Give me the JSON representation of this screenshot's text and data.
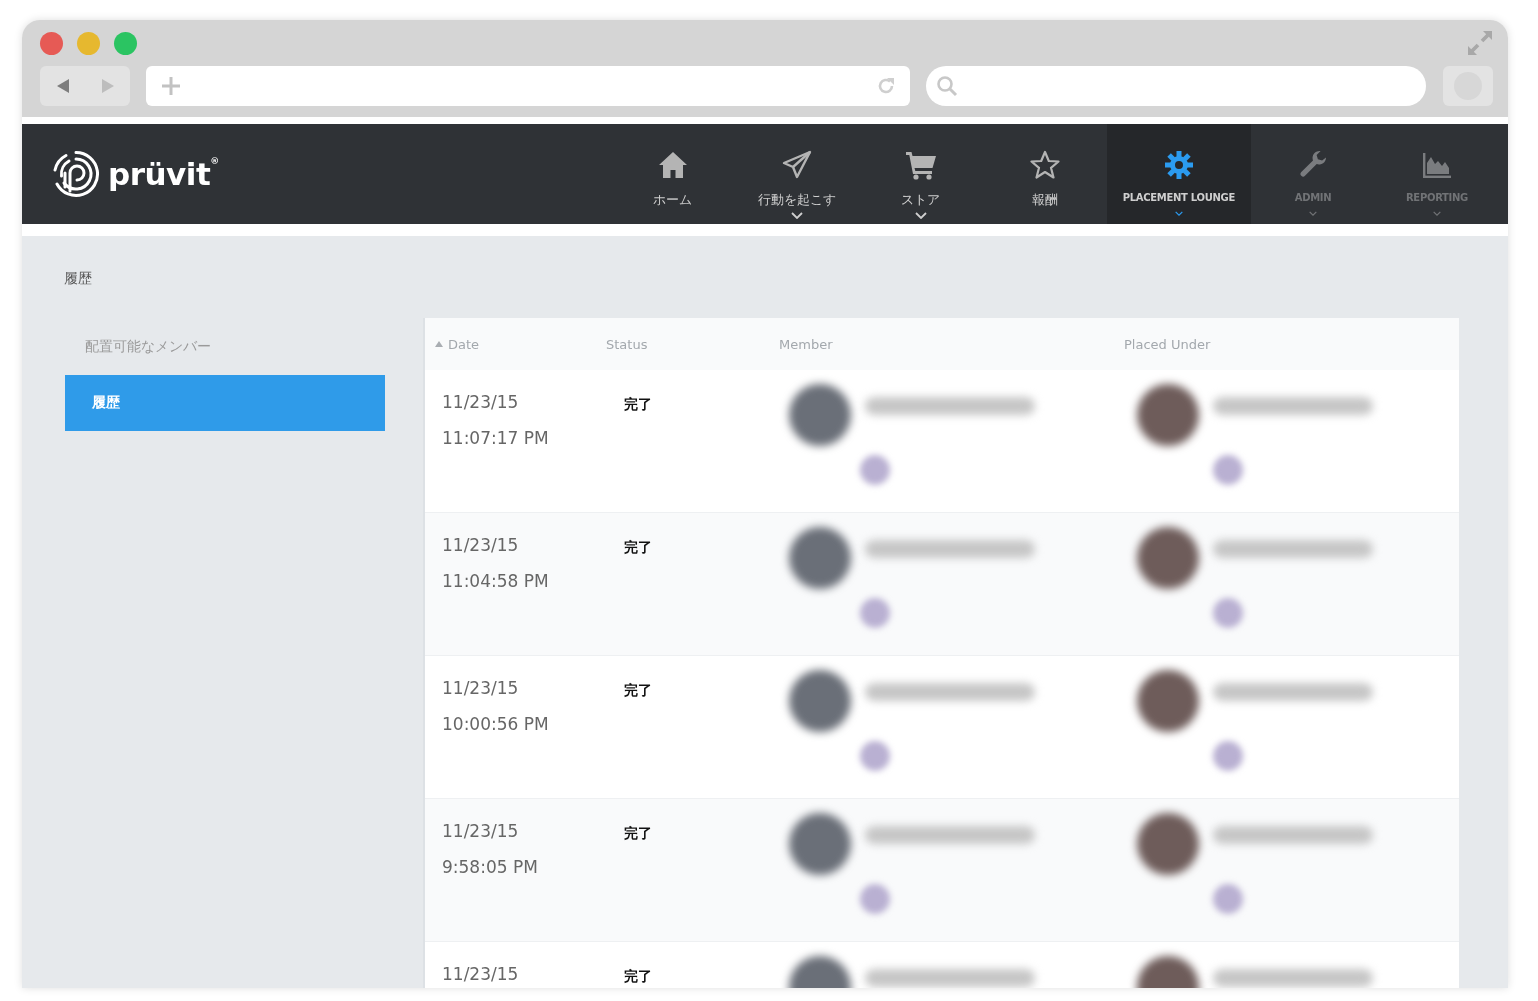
{
  "browser": {
    "window_controls": [
      {
        "color": "#e65a55"
      },
      {
        "color": "#e6b82f"
      },
      {
        "color": "#2bc462"
      }
    ]
  },
  "header": {
    "logo": "prüvit$^{®}$",
    "nav": [
      {
        "label": "ホーム",
        "kind": "primary",
        "selected": false,
        "disabled": false,
        "dropdown": false
      },
      {
        "label": "行動を起こす",
        "kind": "primary",
        "selected": false,
        "disabled": false,
        "dropdown": true
      },
      {
        "label": "ストア",
        "kind": "primary",
        "selected": false,
        "disabled": false,
        "dropdown": true
      },
      {
        "label": "報酬",
        "kind": "primary",
        "selected": false,
        "disabled": false,
        "dropdown": false
      },
      {
        "label": "PLACEMENT LOUNGE",
        "kind": "secondary",
        "selected": true,
        "disabled": false,
        "dropdown": true
      },
      {
        "label": "ADMIN",
        "kind": "secondary",
        "selected": false,
        "disabled": true,
        "dropdown": true
      },
      {
        "label": "REPORTING",
        "kind": "secondary",
        "selected": false,
        "disabled": true,
        "dropdown": true
      }
    ]
  },
  "sidebar": {
    "title": "履歴",
    "items": [
      {
        "label": "配置可能なメンバー",
        "selected": false
      },
      {
        "label": "履歴",
        "selected": true
      }
    ]
  },
  "table": {
    "columns": [
      {
        "label": "Date",
        "sorted": true
      },
      {
        "label": "Status",
        "sorted": false
      },
      {
        "label": "Member",
        "sorted": false
      },
      {
        "label": "Placed Under",
        "sorted": false
      }
    ],
    "rows": [
      {
        "date": "11/23/15",
        "time": "11:07:17 PM",
        "status": "完了"
      },
      {
        "date": "11/23/15",
        "time": "11:04:58 PM",
        "status": "完了"
      },
      {
        "date": "11/23/15",
        "time": "10:00:56 PM",
        "status": "完了"
      },
      {
        "date": "11/23/15",
        "time": "9:58:05 PM",
        "status": "完了"
      },
      {
        "date": "11/23/15",
        "status": "完了"
      }
    ]
  }
}
